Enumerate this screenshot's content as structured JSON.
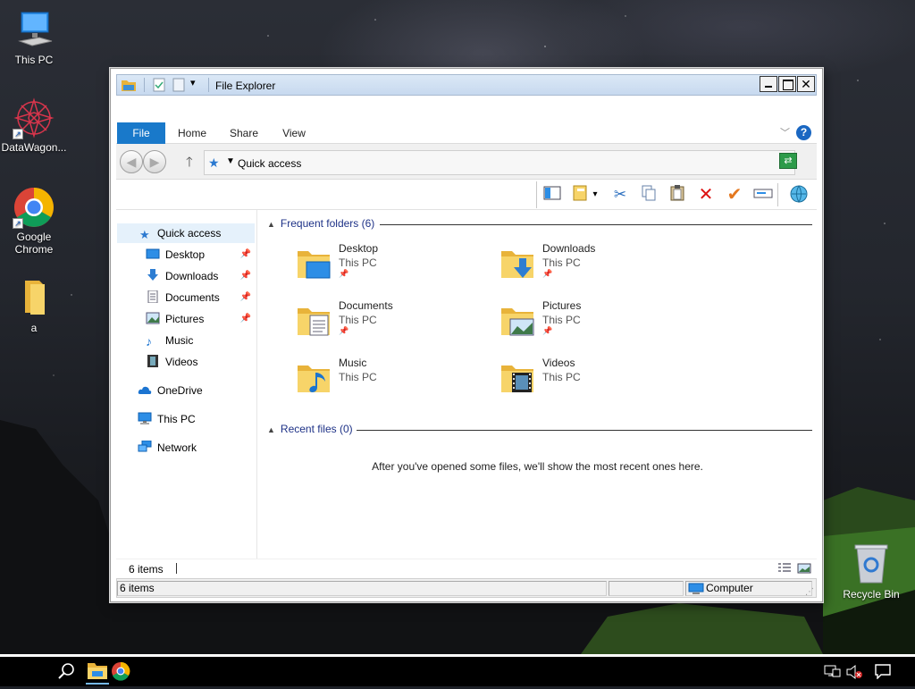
{
  "desktop": {
    "icons": [
      {
        "label": "This PC",
        "icon": "computer-icon"
      },
      {
        "label": "DataWagon...",
        "icon": "datawagon-icon"
      },
      {
        "label": "Google Chrome",
        "icon": "chrome-icon"
      },
      {
        "label": "a",
        "icon": "folder-icon"
      },
      {
        "label": "Recycle Bin",
        "icon": "recycle-bin-icon"
      }
    ]
  },
  "window": {
    "title": "File Explorer",
    "ribbon_tabs": [
      "File",
      "Home",
      "Share",
      "View"
    ],
    "help_label": "?",
    "address": {
      "text": "Quick access"
    },
    "nav": {
      "items": [
        {
          "label": "Quick access"
        },
        {
          "label": "Desktop"
        },
        {
          "label": "Downloads"
        },
        {
          "label": "Documents"
        },
        {
          "label": "Pictures"
        },
        {
          "label": "Music"
        },
        {
          "label": "Videos"
        },
        {
          "label": "OneDrive"
        },
        {
          "label": "This PC"
        },
        {
          "label": "Network"
        }
      ]
    },
    "frequent": {
      "header": "Frequent folders (6)",
      "tiles": [
        {
          "name": "Desktop",
          "location": "This PC"
        },
        {
          "name": "Downloads",
          "location": "This PC"
        },
        {
          "name": "Documents",
          "location": "This PC"
        },
        {
          "name": "Pictures",
          "location": "This PC"
        },
        {
          "name": "Music",
          "location": "This PC"
        },
        {
          "name": "Videos",
          "location": "This PC"
        }
      ]
    },
    "recent": {
      "header": "Recent files (0)",
      "empty_message": "After you've opened some files, we'll show the most recent ones here."
    },
    "status": {
      "item_count": "6 items",
      "bottom_left": "6 items",
      "bottom_right": "Computer"
    }
  },
  "colors": {
    "accent": "#1979ca",
    "header_text": "#1e3287",
    "folder": "#f4c34f"
  }
}
